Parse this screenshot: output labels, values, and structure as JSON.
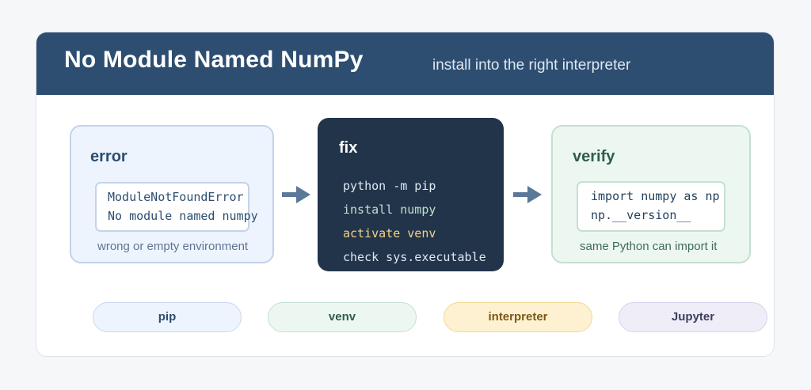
{
  "header": {
    "title": "No Module Named NumPy",
    "subtitle": "install into the right interpreter"
  },
  "error": {
    "title": "error",
    "code": [
      "ModuleNotFoundError",
      "No module named numpy"
    ],
    "caption": "wrong or empty environment"
  },
  "fix": {
    "title": "fix",
    "lines": [
      "python -m pip",
      "install numpy",
      "activate venv",
      "check sys.executable"
    ]
  },
  "verify": {
    "title": "verify",
    "code": [
      "import numpy as np",
      "np.__version__"
    ],
    "caption": "same Python can import it"
  },
  "tags": [
    "pip",
    "venv",
    "interpreter",
    "Jupyter"
  ],
  "colors": {
    "header": "#2d4e70",
    "fix_panel": "#22344a",
    "arrow": "#5a7899",
    "highlight": "#f2d486"
  },
  "icons": [
    "arrow-right-icon",
    "arrow-right-icon"
  ]
}
